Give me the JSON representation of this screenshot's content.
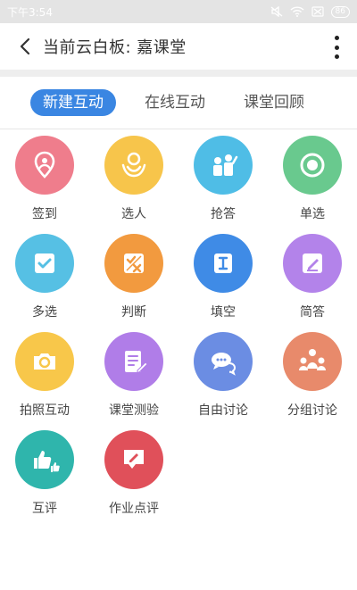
{
  "status": {
    "time": "下午3:54",
    "battery": "86"
  },
  "header": {
    "title": "当前云白板: 嘉课堂"
  },
  "tabs": [
    {
      "label": "新建互动",
      "active": true
    },
    {
      "label": "在线互动",
      "active": false
    },
    {
      "label": "课堂回顾",
      "active": false
    }
  ],
  "items": [
    {
      "label": "签到",
      "icon": "location-pin-icon",
      "color": "#ef7d8c"
    },
    {
      "label": "选人",
      "icon": "person-select-icon",
      "color": "#f7c54b"
    },
    {
      "label": "抢答",
      "icon": "people-answer-icon",
      "color": "#4fbde6"
    },
    {
      "label": "单选",
      "icon": "radio-icon",
      "color": "#69c98e"
    },
    {
      "label": "多选",
      "icon": "checkbox-icon",
      "color": "#56c0e4"
    },
    {
      "label": "判断",
      "icon": "true-false-icon",
      "color": "#f29a3f"
    },
    {
      "label": "填空",
      "icon": "fill-blank-icon",
      "color": "#3f8be6"
    },
    {
      "label": "简答",
      "icon": "edit-note-icon",
      "color": "#b383ea"
    },
    {
      "label": "拍照互动",
      "icon": "camera-icon",
      "color": "#f8c74a"
    },
    {
      "label": "课堂测验",
      "icon": "quiz-icon",
      "color": "#b07de8"
    },
    {
      "label": "自由讨论",
      "icon": "chat-bubbles-icon",
      "color": "#6b8de3"
    },
    {
      "label": "分组讨论",
      "icon": "group-icon",
      "color": "#e88a6b"
    },
    {
      "label": "互评",
      "icon": "thumbs-up-icon",
      "color": "#2fb5ac"
    },
    {
      "label": "作业点评",
      "icon": "comment-edit-icon",
      "color": "#e0505a"
    }
  ]
}
